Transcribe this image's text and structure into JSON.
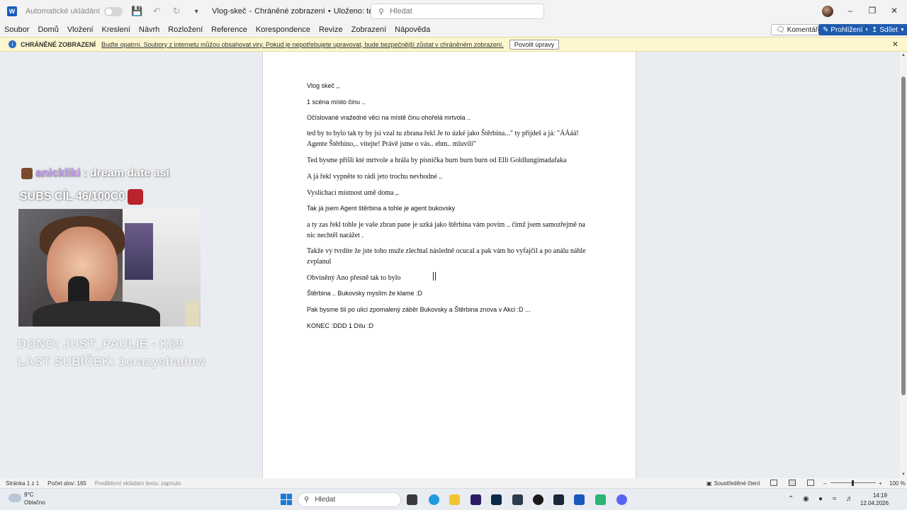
{
  "titlebar": {
    "autosave_label": "Automatické ukládání",
    "doc_name": "Vlog-skeč",
    "doc_status1": "Chráněné zobrazení",
    "doc_status2": "Uloženo: tento počítač",
    "search_placeholder": "Hledat"
  },
  "menu": [
    "Soubor",
    "Domů",
    "Vložení",
    "Kreslení",
    "Návrh",
    "Rozložení",
    "Reference",
    "Korespondence",
    "Revize",
    "Zobrazení",
    "Nápověda"
  ],
  "actions": {
    "comments": "Komentáře",
    "view": "Prohlížení",
    "share": "Sdílet"
  },
  "protected_view": {
    "title": "CHRÁNĚNÉ ZOBRAZENÍ",
    "message": "Buďte opatrní. Soubory z internetu můžou obsahovat viry. Pokud je nepotřebujete upravovat, bude bezpečnější zůstat v chráněném zobrazení.",
    "button": "Povolit úpravy"
  },
  "document": [
    {
      "text": "Vlog skeč ,,",
      "font": "sans"
    },
    {
      "text": "1 scéna místo činu ..",
      "font": "sans"
    },
    {
      "text": "Očíslované vražedné věci na místě činu ohořelá mrtvola ..",
      "font": "sans"
    },
    {
      "text": "ted by to bylo tak ty by jsi vzal tu zbrana řekl Je to úzké jako Štěrbina...\" ty přijdeš a já: \"ÁÁáá! Agente Štěrbino,.. vítejte! Právě jsme o vás.. ehm.. mluvili\"",
      "font": "serif"
    },
    {
      "text": "Ted bysme přišli kté mrtvole a hrála by písnička burn burn burn od Elli Goldlungimadafaka",
      "font": "serif"
    },
    {
      "text": "A já řekl vypněte to rádi jeto trochu nevhodné ..",
      "font": "serif"
    },
    {
      "text": "Vyslíchací místnost umě doma ,.",
      "font": "serif"
    },
    {
      "text": "Tak já jsem Agent štěrbina a tohle je agent bukovsky",
      "font": "sans"
    },
    {
      "text": "a ty zas řekl tohle je vaše zbran pane je uzká jako štěrbina vám povím .. čímž jsem samozřejmě na nic nechtěl narážet .",
      "font": "serif"
    },
    {
      "text": "Takže vy tvrdíte že jste toho muže zlechtal následně ocucal a pak vám ho vyfajčil a po análu náhle zvplanul",
      "font": "serif"
    },
    {
      "text": "Obviněný Ano přesně tak to bylo",
      "font": "serif"
    },
    {
      "text": "Štěrbina .. Bukovsky myslím že klame :D",
      "font": "sans"
    },
    {
      "text": "Pak bysme šli po ulici zpomalený záběr Bukovsky a Štěrbina znova v Akci :D  ...",
      "font": "sans"
    },
    {
      "text": "KONEC :DDD 1 Dílu :D",
      "font": "sans"
    }
  ],
  "stream_overlay": {
    "chat_user": "anickliki",
    "chat_message": ": dream date asi",
    "sub_goal": "SUBS CÍL 46/100C0",
    "donation": "DONO: JUST_PAULIE - Kč9",
    "last_sub": "LAST SUBÍČEK: 1crazyshadow"
  },
  "statusbar": {
    "page": "Stránka 1 z 1",
    "words": "Počet slov: 165",
    "predictive": "Prediktivní vkládání textu: zapnuto",
    "focus": "Soustředěné čtení",
    "zoom": "100 %"
  },
  "taskbar": {
    "temp": "9°C",
    "weather": "Oblačno",
    "search": "Hledat",
    "time": "14:19",
    "date": "12.04.2026"
  },
  "colors": {
    "accent": "#185abd",
    "protected_bar": "#fdf6cf",
    "overlay_user": "#c69bf2"
  }
}
